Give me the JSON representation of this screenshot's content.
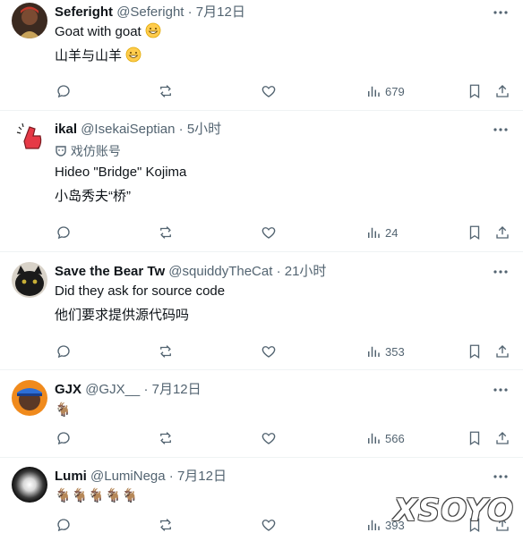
{
  "tweets": [
    {
      "name": "Seferight",
      "handle": "@Seferight",
      "time": "· 7月12日",
      "lines": [
        "Goat with goat",
        "山羊与山羊"
      ],
      "stats": {
        "views": "679"
      }
    },
    {
      "name": "ikal",
      "handle": "@IsekaiSeptian",
      "time": "· 5小时",
      "badge": "戏仿账号",
      "lines": [
        "Hideo \"Bridge\" Kojima",
        "小岛秀夫“桥”"
      ],
      "stats": {
        "views": "24"
      }
    },
    {
      "name": "Save the Bear Tw",
      "handle": "@squiddyTheCat",
      "time": "· 21小时",
      "lines": [
        "Did they ask for source code",
        "他们要求提供源代码吗"
      ],
      "stats": {
        "views": "353"
      }
    },
    {
      "name": "GJX",
      "handle": "@GJX__",
      "time": "· 7月12日",
      "lines": [
        "🐐"
      ],
      "stats": {
        "views": "566"
      }
    },
    {
      "name": "Lumi",
      "handle": "@LumiNega",
      "time": "· 7月12日",
      "lines": [
        "🐐🐐🐐🐐🐐"
      ],
      "stats": {
        "views": "393"
      }
    }
  ],
  "watermark": "XSOYO",
  "colors": {
    "muted": "#536471",
    "text": "#0f1419",
    "divider": "#eff3f4"
  }
}
